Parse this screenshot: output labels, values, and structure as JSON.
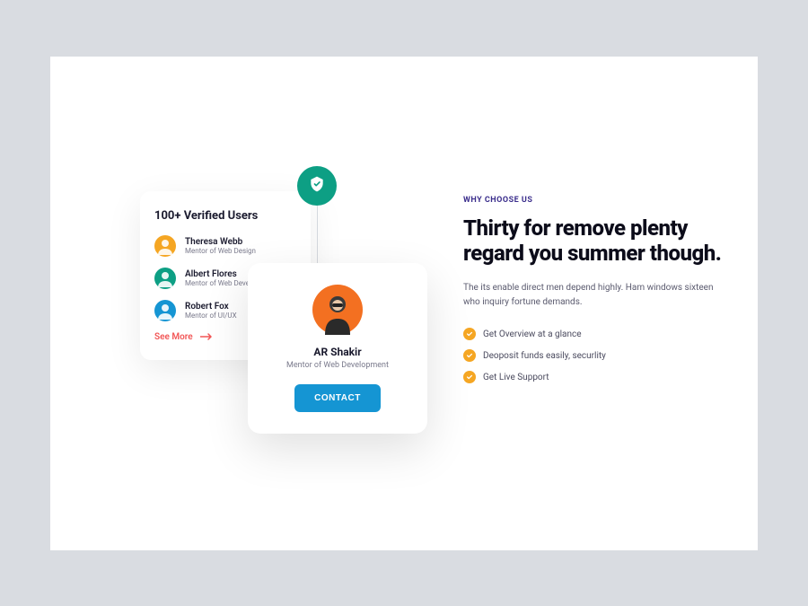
{
  "usersCard": {
    "title": "100+ Verified Users",
    "users": [
      {
        "name": "Theresa Webb",
        "role": "Mentor of Web Design",
        "avatarBg": "#f5a623"
      },
      {
        "name": "Albert Flores",
        "role": "Mentor of Web Development",
        "avatarBg": "#0d9f84"
      },
      {
        "name": "Robert Fox",
        "role": "Mentor of UI/UX",
        "avatarBg": "#1595d3"
      }
    ],
    "seeMore": "See More"
  },
  "profileCard": {
    "name": "AR Shakir",
    "role": "Mentor of Web Development",
    "buttonLabel": "CONTACT",
    "avatarBg": "#f37021"
  },
  "shieldBadge": {
    "icon": "shield-check",
    "bg": "#0d9f84"
  },
  "rightSection": {
    "eyebrow": "WHY CHOOSE US",
    "heading": "Thirty for remove plenty regard you summer though.",
    "description": "The its enable direct men depend highly. Ham windows sixteen who inquiry fortune demands.",
    "features": [
      "Get Overview at a glance",
      "Deoposit funds easily, securlity",
      "Get Live Support"
    ]
  },
  "colors": {
    "accentTeal": "#0d9f84",
    "accentBlue": "#1595d3",
    "accentOrange": "#f5a623",
    "accentRed": "#f25656"
  }
}
